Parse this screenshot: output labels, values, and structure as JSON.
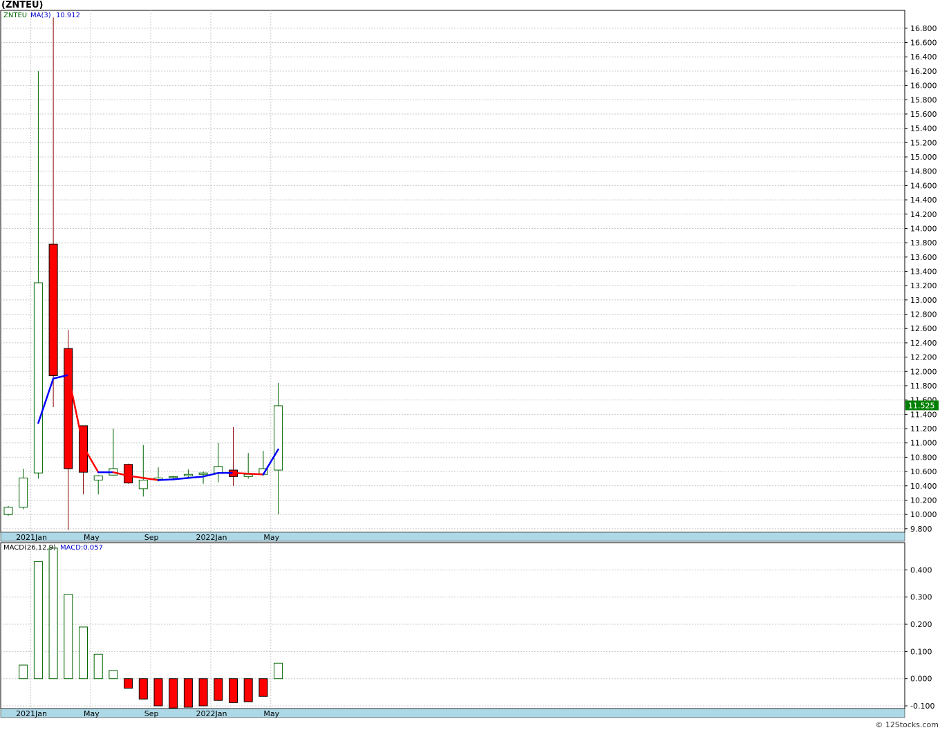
{
  "title": "(ZNTEU)",
  "watermark": "© 12Stocks.com",
  "colors": {
    "up": "#006400",
    "down": "#ff0000",
    "down_wick": "#8b0000",
    "ma_up": "#0000ff",
    "ma_down": "#ff0000",
    "axis_band": "#add8e6",
    "grid": "#c8c8c8"
  },
  "chart_data": [
    {
      "type": "candlestick",
      "legend": {
        "symbol": "ZNTEU",
        "ma_label": "MA(3)",
        "ma_value": "10.912"
      },
      "last_price_label": "11.525",
      "ylim": [
        9.75,
        17.05
      ],
      "y_ticks": [
        "9.800",
        "10.000",
        "10.200",
        "10.400",
        "10.600",
        "10.800",
        "11.000",
        "11.200",
        "11.400",
        "11.600",
        "11.800",
        "12.000",
        "12.200",
        "12.400",
        "12.600",
        "12.800",
        "13.000",
        "13.200",
        "13.400",
        "13.600",
        "13.800",
        "14.000",
        "14.200",
        "14.400",
        "14.600",
        "14.800",
        "15.000",
        "15.200",
        "15.400",
        "15.600",
        "15.800",
        "16.000",
        "16.200",
        "16.400",
        "16.600",
        "16.800"
      ],
      "x_labels": [
        {
          "index": 2,
          "label": "2021Jan"
        },
        {
          "index": 6,
          "label": "May"
        },
        {
          "index": 10,
          "label": "Sep"
        },
        {
          "index": 14,
          "label": "2022Jan"
        },
        {
          "index": 18,
          "label": "May"
        }
      ],
      "candles": [
        {
          "o": 10.0,
          "h": 10.12,
          "l": 9.98,
          "c": 10.1
        },
        {
          "o": 10.1,
          "h": 10.64,
          "l": 10.07,
          "c": 10.51
        },
        {
          "o": 10.58,
          "h": 16.2,
          "l": 10.5,
          "c": 13.24
        },
        {
          "o": 13.78,
          "h": 16.95,
          "l": 11.5,
          "c": 11.94
        },
        {
          "o": 12.32,
          "h": 12.58,
          "l": 9.78,
          "c": 10.64
        },
        {
          "o": 11.24,
          "h": 11.24,
          "l": 10.28,
          "c": 10.59
        },
        {
          "o": 10.48,
          "h": 10.55,
          "l": 10.28,
          "c": 10.54
        },
        {
          "o": 10.55,
          "h": 11.2,
          "l": 10.55,
          "c": 10.64
        },
        {
          "o": 10.7,
          "h": 10.71,
          "l": 10.43,
          "c": 10.44
        },
        {
          "o": 10.36,
          "h": 10.97,
          "l": 10.25,
          "c": 10.48
        },
        {
          "o": 10.49,
          "h": 10.66,
          "l": 10.46,
          "c": 10.51
        },
        {
          "o": 10.52,
          "h": 10.54,
          "l": 10.5,
          "c": 10.53
        },
        {
          "o": 10.54,
          "h": 10.63,
          "l": 10.51,
          "c": 10.56
        },
        {
          "o": 10.56,
          "h": 10.6,
          "l": 10.43,
          "c": 10.58
        },
        {
          "o": 10.58,
          "h": 11.0,
          "l": 10.45,
          "c": 10.67
        },
        {
          "o": 10.62,
          "h": 11.22,
          "l": 10.4,
          "c": 10.53
        },
        {
          "o": 10.53,
          "h": 10.86,
          "l": 10.5,
          "c": 10.56
        },
        {
          "o": 10.56,
          "h": 10.89,
          "l": 10.54,
          "c": 10.64
        },
        {
          "o": 10.62,
          "h": 11.84,
          "l": 10.0,
          "c": 11.52
        }
      ],
      "ma": [
        null,
        null,
        11.28,
        11.9,
        11.95,
        10.95,
        10.59,
        10.59,
        10.54,
        10.51,
        10.48,
        10.49,
        10.51,
        10.53,
        10.58,
        10.58,
        10.57,
        10.56,
        10.91
      ]
    },
    {
      "type": "bar",
      "legend": {
        "label": "MACD(26,12,9)",
        "value_label": "MACD:0.057"
      },
      "ylim": [
        -0.11,
        0.5
      ],
      "y_ticks": [
        "-0.100",
        "0.000",
        "0.100",
        "0.200",
        "0.300",
        "0.400"
      ],
      "x_labels": [
        {
          "index": 2,
          "label": "2021Jan"
        },
        {
          "index": 6,
          "label": "May"
        },
        {
          "index": 10,
          "label": "Sep"
        },
        {
          "index": 14,
          "label": "2022Jan"
        },
        {
          "index": 18,
          "label": "May"
        }
      ],
      "values": [
        null,
        0.05,
        0.43,
        0.48,
        0.31,
        0.19,
        0.09,
        0.03,
        -0.035,
        -0.075,
        -0.1,
        -0.108,
        -0.105,
        -0.1,
        -0.08,
        -0.088,
        -0.085,
        -0.065,
        0.057
      ]
    }
  ]
}
